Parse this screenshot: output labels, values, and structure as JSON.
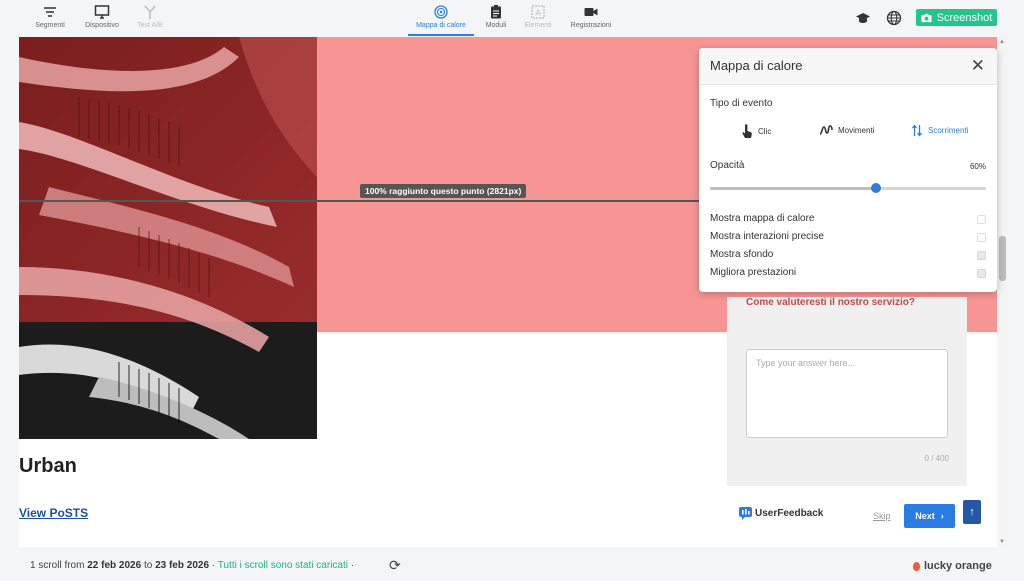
{
  "toolbar": {
    "tools": [
      {
        "label": "Segmenti",
        "icon": "filter-icon",
        "state": "normal"
      },
      {
        "label": "Dispositivo",
        "icon": "monitor-icon",
        "state": "normal"
      },
      {
        "label": "Test A/B",
        "icon": "split-icon",
        "state": "disabled"
      },
      {
        "label": "Mappa di calore",
        "icon": "heatmap-icon",
        "state": "active"
      },
      {
        "label": "Moduli",
        "icon": "clipboard-icon",
        "state": "normal"
      },
      {
        "label": "Elementi",
        "icon": "element-icon",
        "state": "disabled"
      },
      {
        "label": "Registrazioni",
        "icon": "camera-icon",
        "state": "normal"
      }
    ],
    "screenshot_label": "Screenshot"
  },
  "stage": {
    "scroll_tag": "100% raggiunto questo punto (2821px)",
    "heading": "Urban",
    "link": "View PoSTS"
  },
  "survey": {
    "question": "Come valuteresti il nostro servizio?",
    "placeholder": "Type your answer here...",
    "counter": "0 / 400",
    "brand": "UserFeedback",
    "skip_label": "Skip",
    "next_label": "Next"
  },
  "panel": {
    "title": "Mappa di calore",
    "event_type_label": "Tipo di evento",
    "events": [
      {
        "label": "Clic",
        "icon": "tap-icon",
        "selected": false
      },
      {
        "label": "Movimenti",
        "icon": "squiggle-icon",
        "selected": false
      },
      {
        "label": "Scorrimenti",
        "icon": "scroll-arrows-icon",
        "selected": true
      }
    ],
    "opacity_label": "Opacità",
    "opacity_value": "60%",
    "opacity_fraction": 0.6,
    "options": [
      {
        "label": "Mostra mappa di calore",
        "checked": false
      },
      {
        "label": "Mostra interazioni precise",
        "checked": false
      },
      {
        "label": "Mostra sfondo",
        "checked": true
      },
      {
        "label": "Migliora prestazioni",
        "checked": true
      }
    ]
  },
  "footer": {
    "scroll_count": "1 scroll from",
    "date_from": "22 feb 2026",
    "to_word": "to",
    "date_to": "23 feb 2026",
    "sep": "·",
    "status": "Tutti i scroll sono stati caricati",
    "brand": "lucky orange"
  },
  "colors": {
    "accent": "#2b7de0",
    "heat": "#f79595",
    "screenshot_button": "#22c58b"
  }
}
